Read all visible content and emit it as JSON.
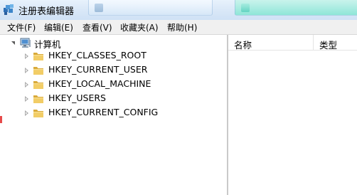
{
  "window": {
    "title": "注册表编辑器"
  },
  "background_windows": [
    "",
    ""
  ],
  "menu": [
    {
      "label": "文件(F)"
    },
    {
      "label": "编辑(E)"
    },
    {
      "label": "查看(V)"
    },
    {
      "label": "收藏夹(A)"
    },
    {
      "label": "帮助(H)"
    }
  ],
  "tree": {
    "root": {
      "label": "计算机",
      "icon": "computer-icon",
      "expanded": true
    },
    "keys": [
      {
        "label": "HKEY_CLASSES_ROOT",
        "icon": "folder-icon",
        "expanded": false
      },
      {
        "label": "HKEY_CURRENT_USER",
        "icon": "folder-icon",
        "expanded": false
      },
      {
        "label": "HKEY_LOCAL_MACHINE",
        "icon": "folder-icon",
        "expanded": false
      },
      {
        "label": "HKEY_USERS",
        "icon": "folder-icon",
        "expanded": false
      },
      {
        "label": "HKEY_CURRENT_CONFIG",
        "icon": "folder-icon",
        "expanded": false
      }
    ]
  },
  "list": {
    "columns": [
      {
        "label": "名称"
      },
      {
        "label": "类型"
      }
    ]
  },
  "colors": {
    "titlebar": "#dbe9f8",
    "menubar": "#f0f0f0",
    "folder": "#e8c25a",
    "splitter": "#c9c9c9"
  }
}
